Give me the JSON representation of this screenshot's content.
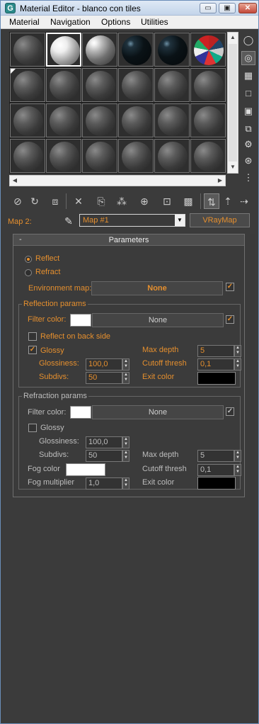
{
  "window": {
    "title": "Material Editor - blanco con tiles",
    "min": "▭",
    "restore": "▣",
    "close": "✕"
  },
  "menu": [
    "Material",
    "Navigation",
    "Options",
    "Utilities"
  ],
  "map": {
    "label": "Map 2:",
    "name": "Map #1",
    "type": "VRayMap"
  },
  "rollout": {
    "title": "Parameters",
    "reflect": "Reflect",
    "refract": "Refract",
    "environment_map_label": "Environment map:",
    "environment_map_value": "None",
    "reflection": {
      "title": "Reflection params",
      "filter_color_label": "Filter color:",
      "filter_map": "None",
      "reflect_back_label": "Reflect on back side",
      "glossy_label": "Glossy",
      "glossiness_label": "Glossiness:",
      "glossiness": "100,0",
      "subdivs_label": "Subdivs:",
      "subdivs": "50",
      "max_depth_label": "Max depth",
      "max_depth": "5",
      "cutoff_label": "Cutoff thresh",
      "cutoff": "0,1",
      "exit_color_label": "Exit color"
    },
    "refraction": {
      "title": "Refraction params",
      "filter_color_label": "Filter color:",
      "filter_map": "None",
      "glossy_label": "Glossy",
      "glossiness_label": "Glossiness:",
      "glossiness": "100,0",
      "subdivs_label": "Subdivs:",
      "subdivs": "50",
      "max_depth_label": "Max depth",
      "max_depth": "5",
      "fog_color_label": "Fog color",
      "cutoff_label": "Cutoff thresh",
      "cutoff": "0,1",
      "fog_mult_label": "Fog multiplier",
      "fog_mult": "1,0",
      "exit_color_label": "Exit color"
    }
  },
  "colors": {
    "accent": "#e58f2e",
    "panel": "#3b3b3b"
  }
}
